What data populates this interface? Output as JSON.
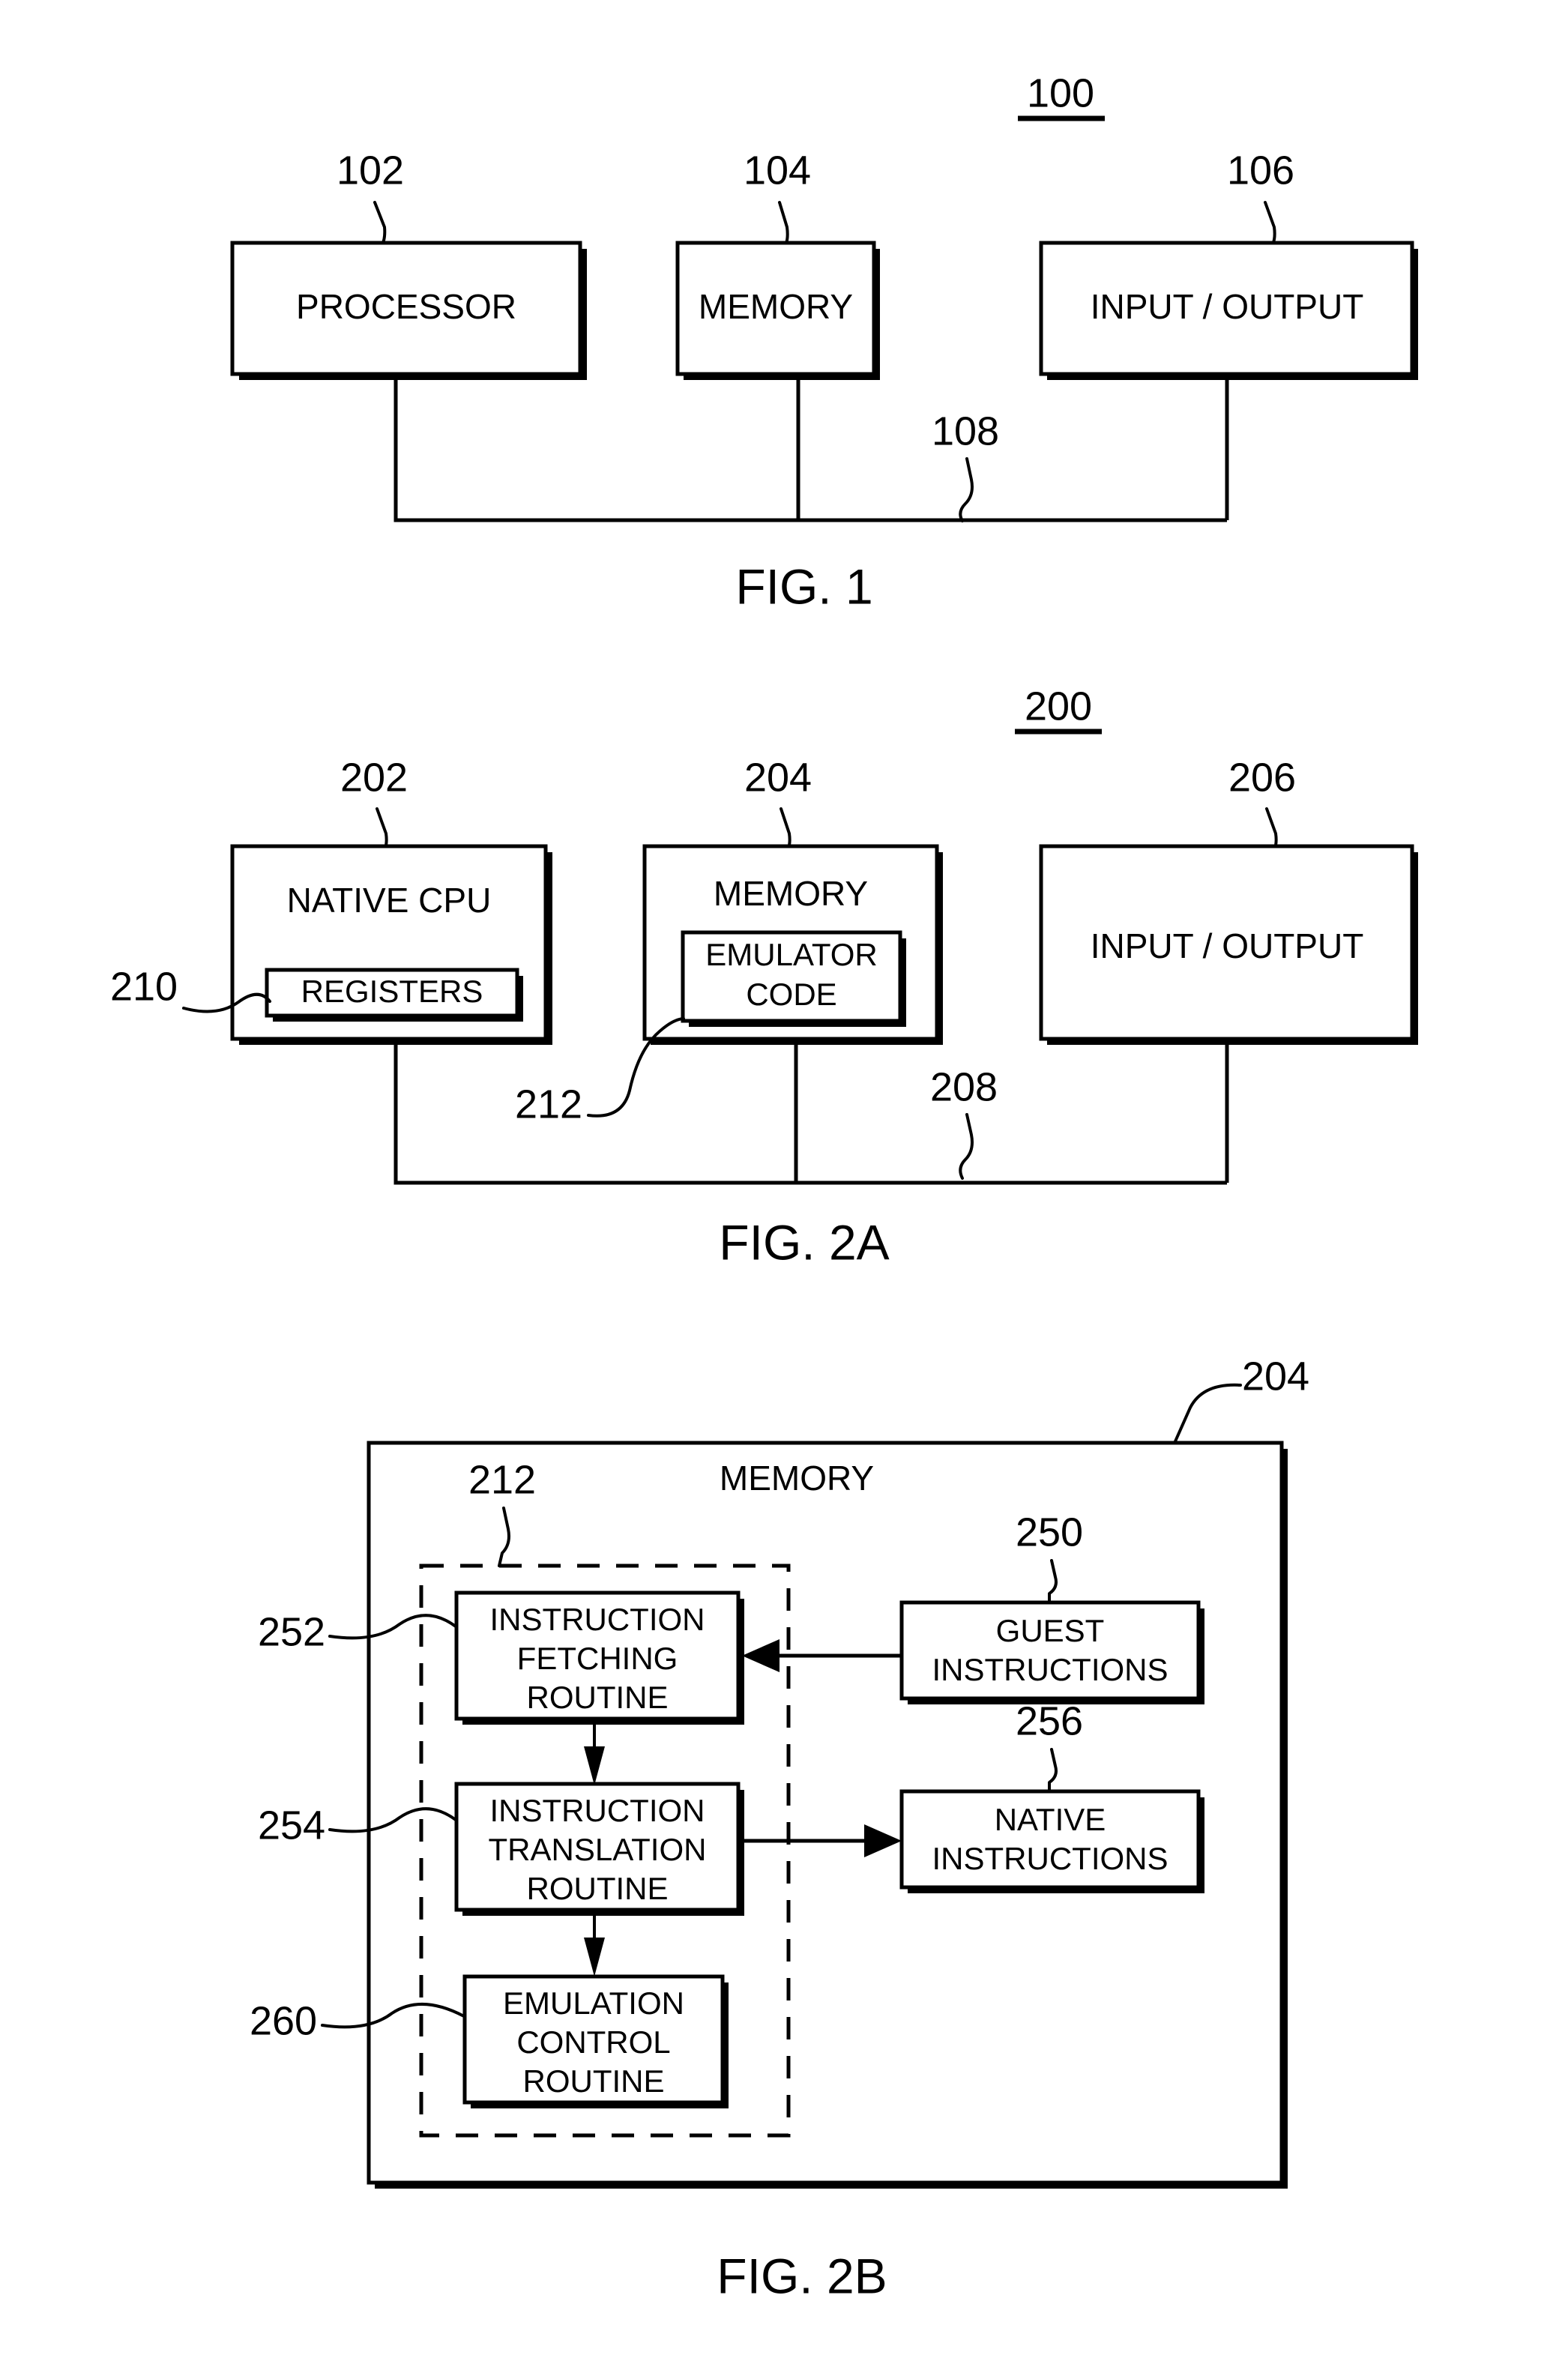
{
  "figures": [
    {
      "id": "fig1",
      "caption": "FIG. 1",
      "system_ref": "100",
      "bus_ref": "108",
      "blocks": [
        {
          "label": "PROCESSOR",
          "ref": "102"
        },
        {
          "label": "MEMORY",
          "ref": "104"
        },
        {
          "label": "INPUT / OUTPUT",
          "ref": "106"
        }
      ]
    },
    {
      "id": "fig2a",
      "caption": "FIG. 2A",
      "system_ref": "200",
      "bus_ref": "208",
      "blocks": [
        {
          "label": "NATIVE CPU",
          "ref": "202",
          "inner_label": "REGISTERS",
          "inner_ref": "210"
        },
        {
          "label": "MEMORY",
          "ref": "204",
          "inner_label_line1": "EMULATOR",
          "inner_label_line2": "CODE",
          "inner_ref": "212"
        },
        {
          "label": "INPUT / OUTPUT",
          "ref": "206"
        }
      ]
    },
    {
      "id": "fig2b",
      "caption": "FIG. 2B",
      "outer_label": "MEMORY",
      "outer_ref": "204",
      "dashed_group_ref": "212",
      "routines": [
        {
          "ref": "252",
          "line1": "INSTRUCTION",
          "line2": "FETCHING",
          "line3": "ROUTINE"
        },
        {
          "ref": "254",
          "line1": "INSTRUCTION",
          "line2": "TRANSLATION",
          "line3": "ROUTINE"
        },
        {
          "ref": "260",
          "line1": "EMULATION",
          "line2": "CONTROL",
          "line3": "ROUTINE"
        }
      ],
      "data_blocks": [
        {
          "ref": "250",
          "line1": "GUEST",
          "line2": "INSTRUCTIONS"
        },
        {
          "ref": "256",
          "line1": "NATIVE",
          "line2": "INSTRUCTIONS"
        }
      ]
    }
  ]
}
